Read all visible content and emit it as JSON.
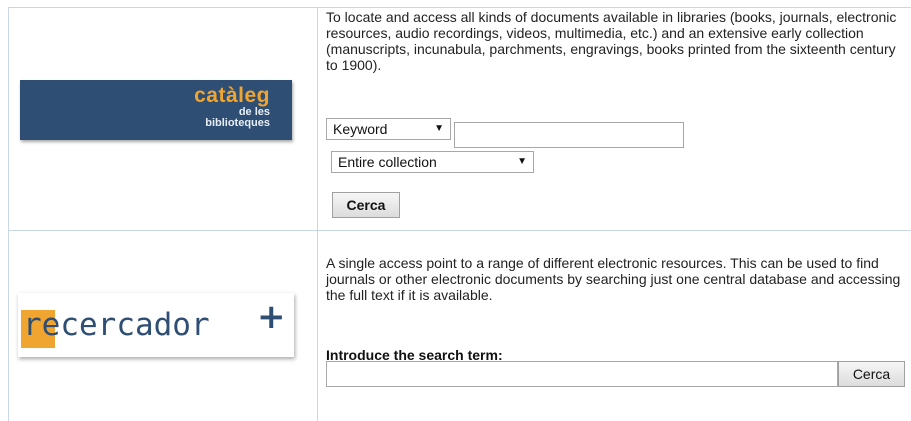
{
  "catalog": {
    "logo": {
      "line1": "catàleg",
      "line2": "de les",
      "line3": "biblioteques"
    },
    "description": "To locate and access all kinds of documents available in libraries (books, journals, electronic resources, audio recordings, videos, multimedia, etc.) and an extensive early collection (manuscripts, incunabula, parchments, engravings, books printed from the sixteenth century to 1900).",
    "search_type_selected": "Keyword",
    "collection_selected": "Entire collection",
    "search_value": "",
    "button_label": "Cerca"
  },
  "recercador": {
    "logo": {
      "prefix": "re",
      "rest": "cercador",
      "plus": "+"
    },
    "description": "A single access point to a range of different electronic resources. This can be used to find journals or other electronic documents by searching just one central database and accessing the full text if it is available.",
    "term_label": "Introduce the search term:",
    "search_value": "",
    "button_label": "Cerca"
  },
  "colors": {
    "brand_blue": "#2f4e73",
    "brand_orange": "#f0a531",
    "grid_line": "#c8d6e6"
  }
}
